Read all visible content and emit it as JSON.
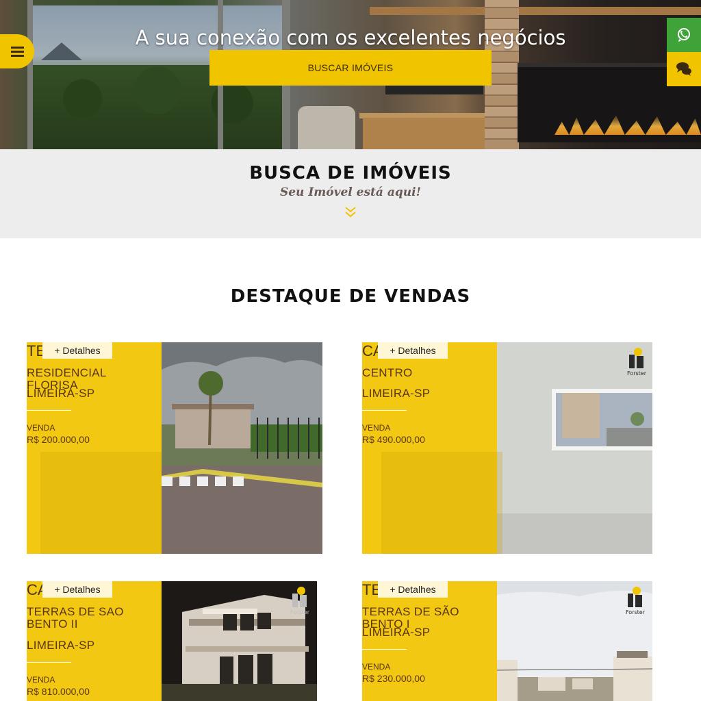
{
  "hero": {
    "title": "A sua conexão com os excelentes negócios",
    "search_button": "BUSCAR IMÓVEIS"
  },
  "icons": {
    "menu": "hamburger-menu-icon",
    "whatsapp": "whatsapp-icon",
    "chat": "chat-bubbles-icon",
    "scroll": "double-chevron-down-icon"
  },
  "busca": {
    "title": "BUSCA DE IMÓVEIS",
    "subtitle": "Seu Imóvel está aqui!"
  },
  "destaque": {
    "title": "DESTAQUE DE VENDAS",
    "cards": [
      {
        "type": "TE",
        "details": "+ Detalhes",
        "name": "RESIDENCIAL FLORISA",
        "city": "LIMEIRA-SP",
        "deal": "VENDA",
        "price": "R$ 200.000,00"
      },
      {
        "type": "CA",
        "details": "+ Detalhes",
        "name": "CENTRO",
        "city": "LIMEIRA-SP",
        "deal": "VENDA",
        "price": "R$ 490.000,00"
      },
      {
        "type": "CA",
        "details": "+ Detalhes",
        "name": "TERRAS DE SAO BENTO II",
        "city": "LIMEIRA-SP",
        "deal": "VENDA",
        "price": "R$ 810.000,00"
      },
      {
        "type": "TE",
        "details": "+ Detalhes",
        "name": "TERRAS DE SÃO BENTO I",
        "city": "LIMEIRA-SP",
        "deal": "VENDA",
        "price": "R$ 230.000,00"
      }
    ]
  },
  "logo_text": "Forster",
  "colors": {
    "accent_yellow": "#f1c400",
    "whatsapp_green": "#3fa33a",
    "band_gray": "#ededed",
    "card_text": "#5a3518"
  }
}
